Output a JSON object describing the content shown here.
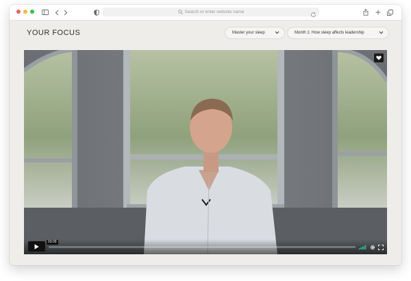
{
  "browser": {
    "address_placeholder": "Search or enter website name"
  },
  "page": {
    "title": "YOUR FOCUS",
    "dropdown_topic": "Master your sleep",
    "dropdown_lesson": "Month 1: How sleep affects leadership"
  },
  "video": {
    "time": "03:09",
    "progress": 0.0
  },
  "colors": {
    "page_bg": "#efedea",
    "traffic_red": "#fe5f57",
    "traffic_yellow": "#febc2e",
    "traffic_green": "#28c840",
    "volume_accent": "#2fb58f"
  },
  "icons": [
    "sidebar-icon",
    "back-icon",
    "forward-icon",
    "shield-icon",
    "search-icon",
    "reload-icon",
    "share-icon",
    "new-tab-icon",
    "tabs-icon",
    "chevron-down-icon",
    "heart-icon",
    "play-icon",
    "volume-icon",
    "settings-icon",
    "fullscreen-icon"
  ]
}
